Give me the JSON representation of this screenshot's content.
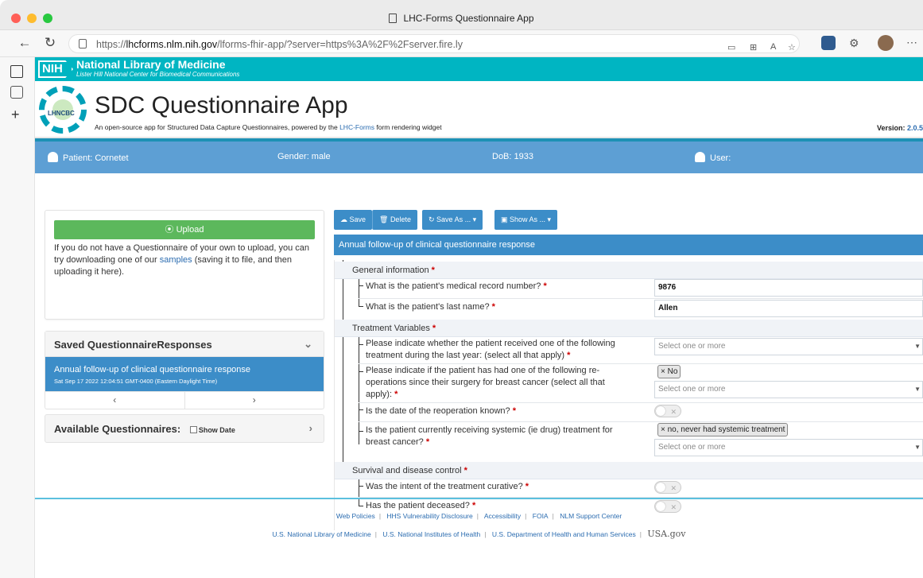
{
  "browser": {
    "tab_title": "LHC-Forms Questionnaire App",
    "url_prefix": "https://",
    "url_host": "lhcforms.nlm.nih.gov",
    "url_path": "/lforms-fhir-app/?server=https%3A%2F%2Fserver.fire.ly"
  },
  "nlm": {
    "badge": "NIH",
    "title": "National Library of Medicine",
    "subtitle": "Lister Hill National Center for Biomedical Communications"
  },
  "header": {
    "logo_text": "LHNCBC",
    "title": "SDC Questionnaire App",
    "desc_before": "An open-source app for Structured Data Capture Questionnaires, powered by the ",
    "desc_link": "LHC-Forms",
    "desc_after": " form rendering widget",
    "version_label": "Version: ",
    "version_value": "2.0.5"
  },
  "patient_bar": {
    "patient": "Patient: Cornetet",
    "gender": "Gender: male",
    "dob": "DoB: 1933",
    "user": "User:"
  },
  "upload": {
    "button": "⦿ Upload",
    "text_before": "If you do not have a Questionnaire of your own to upload, you can try downloading one of our ",
    "text_link": "samples",
    "text_after": " (saving it to file, and then uploading it here)."
  },
  "saved": {
    "heading": "Saved QuestionnaireResponses",
    "item_title": "Annual follow-up of clinical questionnaire response",
    "item_date": "Sat Sep 17 2022 12:04:51 GMT-0400 (Eastern Daylight Time)",
    "prev": "‹",
    "next": "›"
  },
  "available": {
    "heading": "Available Questionnaires:",
    "show_date": "Show Date"
  },
  "toolbar": {
    "save": "Save",
    "delete": "Delete",
    "save_as": "Save As ...",
    "show_as": "Show As ..."
  },
  "form": {
    "title": "Annual follow-up of clinical questionnaire response",
    "groups": {
      "general": "General information",
      "treatment": "Treatment Variables",
      "survival": "Survival and disease control"
    },
    "questions": {
      "mrn": "What is the patient's medical record number?",
      "lastname": "What is the patient's last name?",
      "received": "Please indicate whether the patient received one of the following treatment during the last year: (select all that apply)",
      "reoperations": "Please indicate if the patient has had one of the following re-operations since their surgery for breast cancer (select all that apply):",
      "date_known": "Is the date of the reoperation known?",
      "systemic": "Is the patient currently receiving systemic (ie drug) treatment for breast cancer?",
      "curative": "Was the intent of the treatment curative?",
      "deceased": "Has the patient deceased?"
    },
    "answers": {
      "mrn": "9876",
      "lastname": "Allen",
      "placeholder": "Select one or more",
      "reop_tag": "× No",
      "systemic_tag": "× no, never had systemic treatment"
    },
    "required_mark": "*"
  },
  "footer": {
    "row1": [
      "Web Policies",
      "HHS Vulnerability Disclosure",
      "Accessibility",
      "FOIA",
      "NLM Support Center"
    ],
    "row2": [
      "U.S. National Library of Medicine",
      "U.S. National Institutes of Health",
      "U.S. Department of Health and Human Services"
    ],
    "usa": "USA.gov"
  }
}
